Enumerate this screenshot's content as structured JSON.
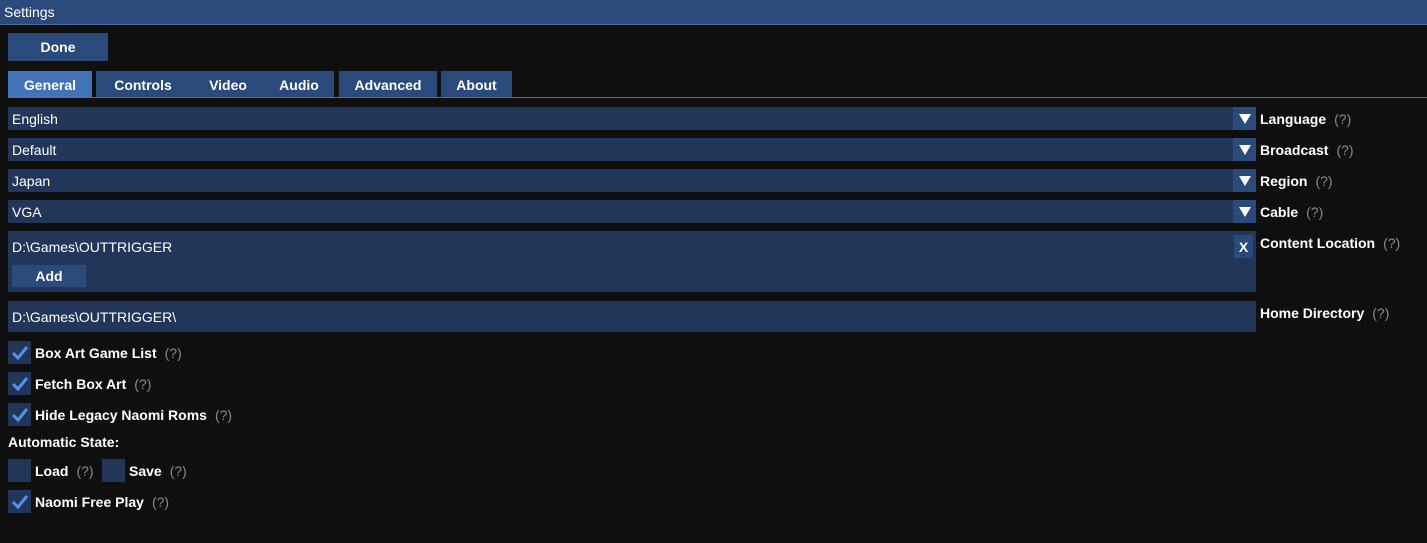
{
  "window": {
    "title": "Settings"
  },
  "toolbar": {
    "done_label": "Done"
  },
  "tabs": [
    {
      "label": "General",
      "active": true
    },
    {
      "label": "Controls",
      "active": false
    },
    {
      "label": "Video",
      "active": false
    },
    {
      "label": "Audio",
      "active": false
    },
    {
      "label": "Advanced",
      "active": false
    },
    {
      "label": "About",
      "active": false
    }
  ],
  "help_marker": "(?)",
  "settings": {
    "language": {
      "value": "English",
      "label": "Language"
    },
    "broadcast": {
      "value": "Default",
      "label": "Broadcast"
    },
    "region": {
      "value": "Japan",
      "label": "Region"
    },
    "cable": {
      "value": "VGA",
      "label": "Cable"
    },
    "content_location": {
      "path": "D:\\Games\\OUTTRIGGER",
      "remove_label": "X",
      "add_label": "Add",
      "label": "Content Location"
    },
    "home_directory": {
      "value": "D:\\Games\\OUTTRIGGER\\",
      "label": "Home Directory"
    }
  },
  "checkboxes": {
    "box_art_game_list": {
      "label": "Box Art Game List",
      "checked": true
    },
    "fetch_box_art": {
      "label": "Fetch Box Art",
      "checked": true
    },
    "hide_legacy_naomi_roms": {
      "label": "Hide Legacy Naomi Roms",
      "checked": true
    },
    "automatic_state_label": "Automatic State:",
    "load": {
      "label": "Load",
      "checked": false
    },
    "save": {
      "label": "Save",
      "checked": false
    },
    "naomi_free_play": {
      "label": "Naomi Free Play",
      "checked": true
    }
  },
  "colors": {
    "background": "#0f0f0f",
    "title_bar": "#294a7a",
    "active_tab": "#4272b8",
    "field": "#213658",
    "check_mark": "#4f94e8",
    "help_text": "#8a8a8a"
  }
}
